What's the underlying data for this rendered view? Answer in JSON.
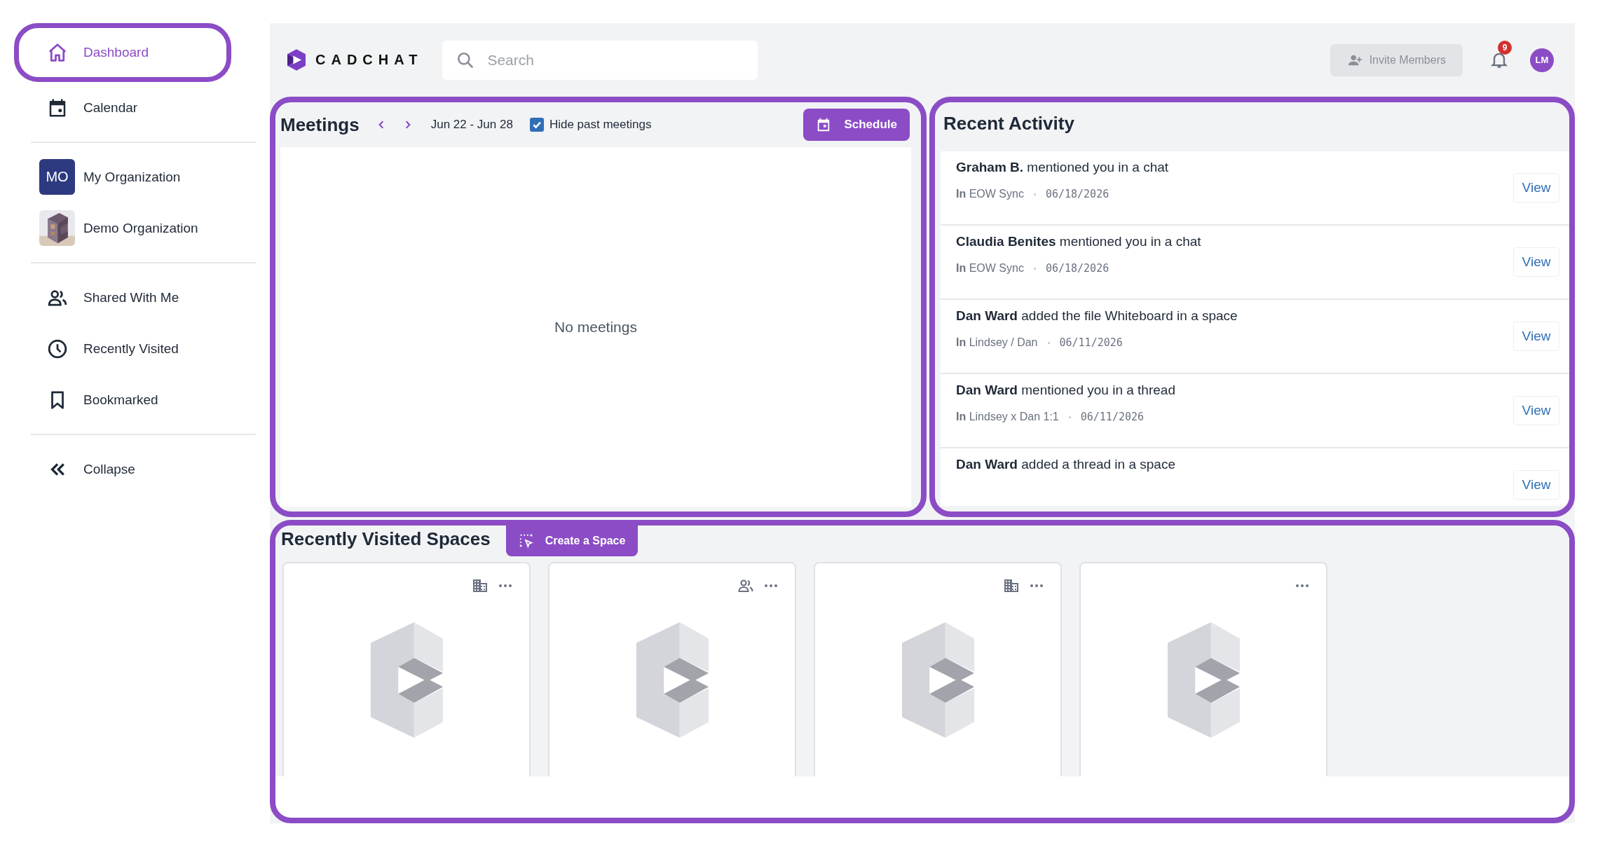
{
  "sidebar": {
    "nav_top": [
      {
        "kind": "home",
        "label": "Dashboard",
        "selected": true
      },
      {
        "kind": "calendar",
        "label": "Calendar",
        "selected": false
      }
    ],
    "organizations": [
      {
        "kind": "initials",
        "initials": "MO",
        "label": "My Organization"
      },
      {
        "kind": "picture",
        "label": "Demo Organization"
      }
    ],
    "nav_bottom": [
      {
        "kind": "people",
        "label": "Shared With Me",
        "selected": false
      },
      {
        "kind": "clock",
        "label": "Recently Visited",
        "selected": false
      },
      {
        "kind": "bookmark",
        "label": "Bookmarked",
        "selected": false
      }
    ],
    "collapse": {
      "label": "Collapse"
    }
  },
  "header": {
    "logo": "CADCHAT",
    "search": {
      "placeholder": "Search"
    },
    "invite_button": {
      "label": "Invite Members",
      "disabled": true
    },
    "notifications": {
      "count": "9"
    },
    "avatar": "LM"
  },
  "meetings": {
    "title": "Meetings",
    "date_range": "Jun 22 - Jun 28",
    "hide_past": {
      "label": "Hide past meetings",
      "checked": true
    },
    "schedule_button": "Schedule",
    "empty_text": "No meetings"
  },
  "recent_activity": {
    "title": "Recent Activity",
    "items": [
      {
        "headline": "**Graham B.** mentioned you in a chat",
        "place": "**In** EOW Sync",
        "date": "06/18/2026",
        "button": "View"
      },
      {
        "headline": "**Claudia Benites** mentioned you in a chat",
        "place": "**In** EOW Sync",
        "date": "06/18/2026",
        "button": "View"
      },
      {
        "headline": "**Dan Ward** added the file Whiteboard in a space",
        "place": "**In** Lindsey / Dan",
        "date": "06/11/2026",
        "button": "View"
      },
      {
        "headline": "**Dan Ward** mentioned you in a thread",
        "place": "**In** Lindsey x Dan 1:1",
        "date": "06/11/2026",
        "button": "View"
      },
      {
        "headline": "**Dan Ward** added a thread in a space",
        "button": "View"
      }
    ]
  },
  "spaces": {
    "title": "Recently Visited Spaces",
    "create_button": "Create a Space",
    "cards": [
      {
        "kind": "organization"
      },
      {
        "kind": "shared"
      },
      {
        "kind": "organization"
      },
      {
        "kind": "plain"
      }
    ]
  }
}
